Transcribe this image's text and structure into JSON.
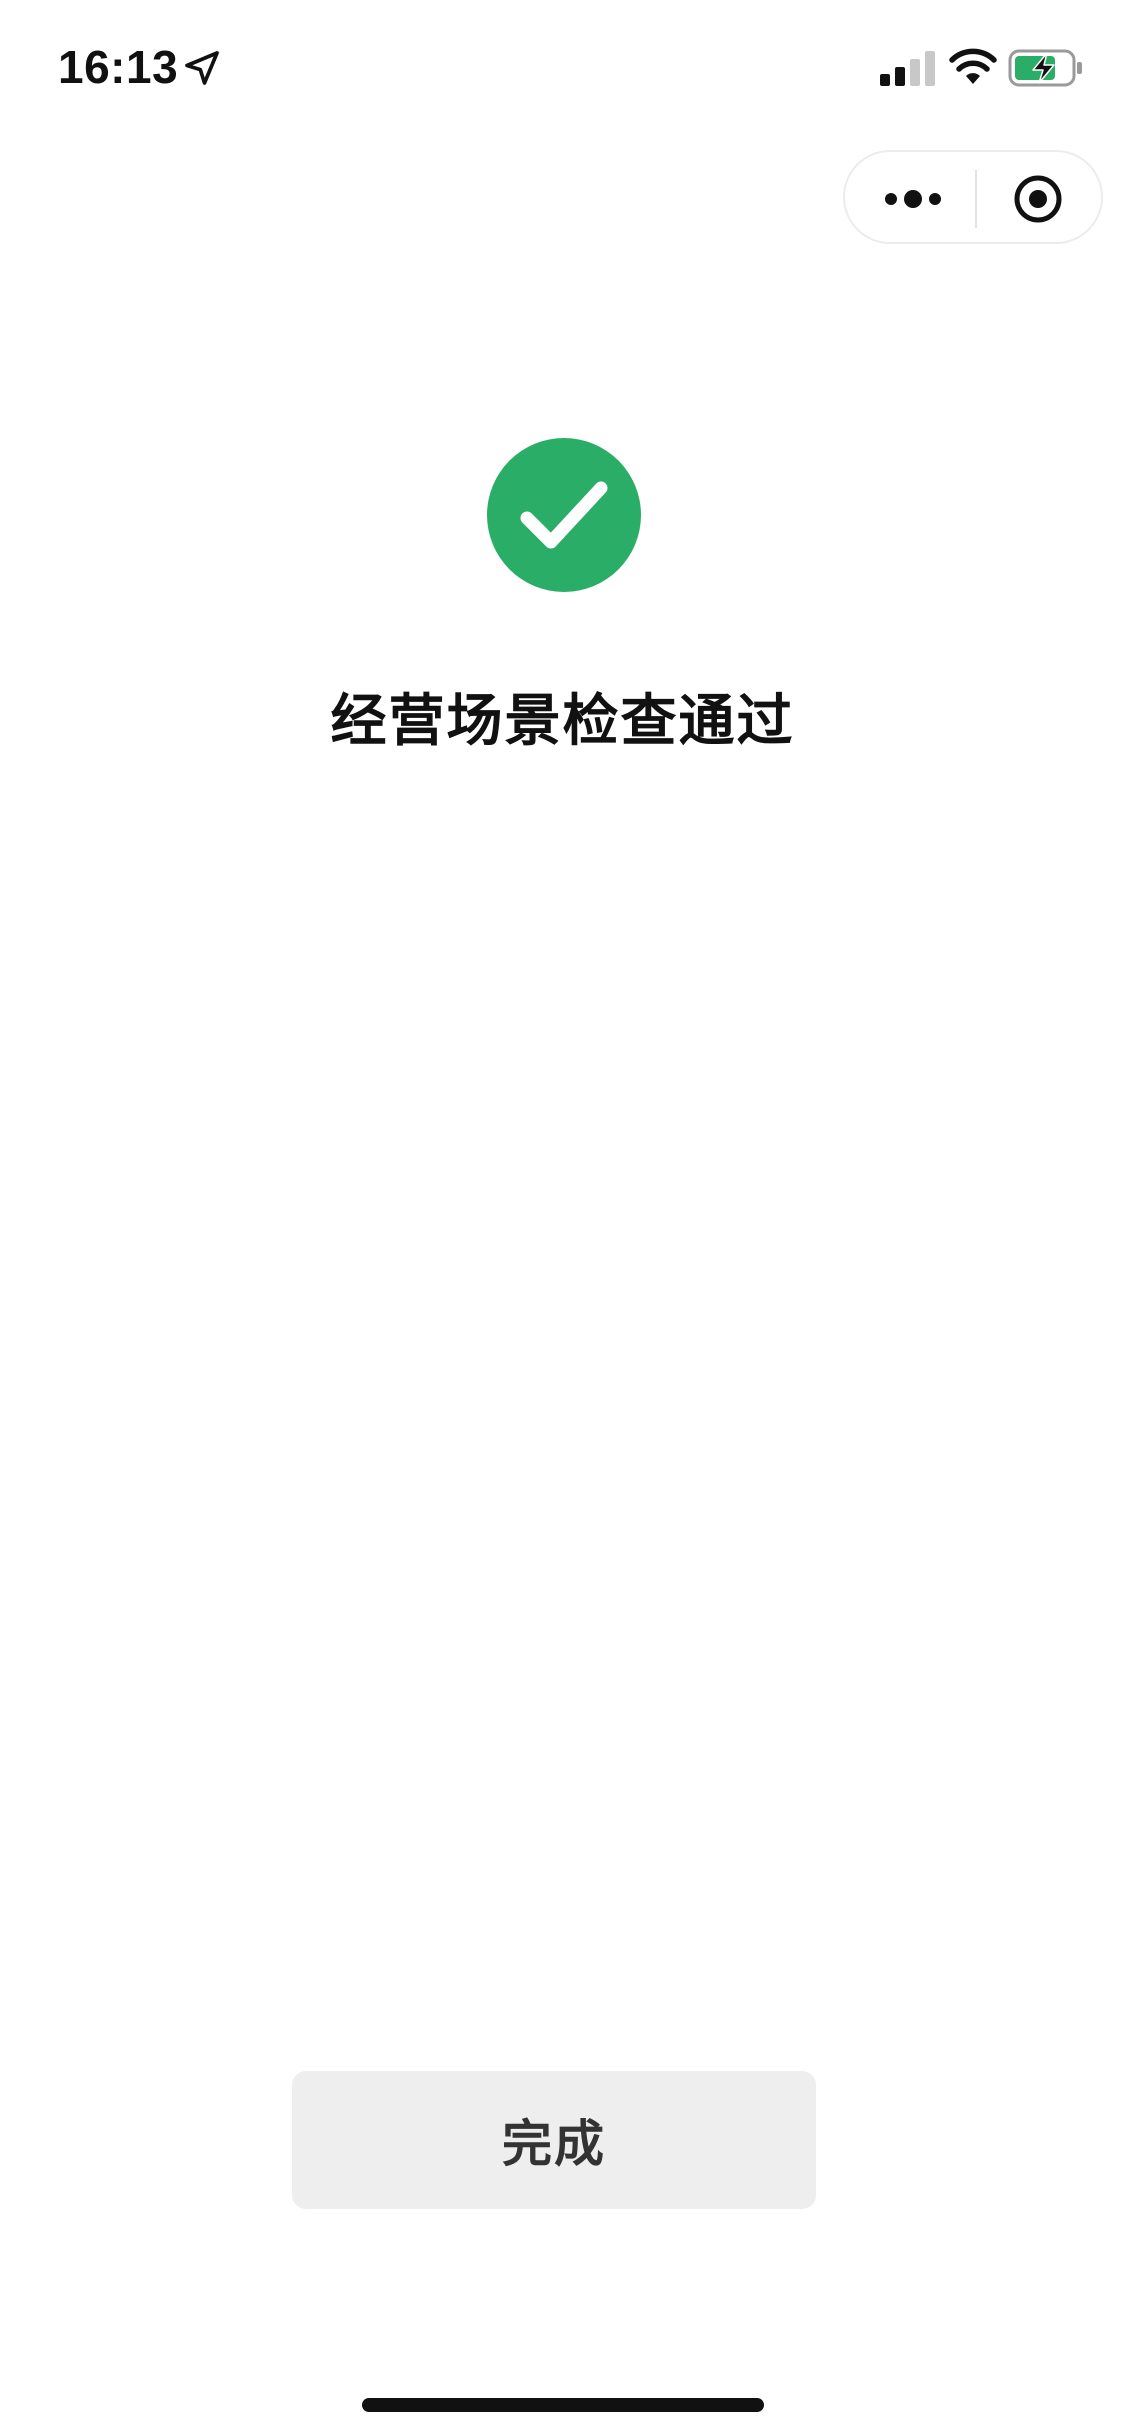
{
  "status_bar": {
    "time": "16:13",
    "icons": [
      "location-arrow-icon",
      "signal-icon",
      "wifi-icon",
      "battery-charging-icon"
    ],
    "battery_color": "#2aae67"
  },
  "capsule": {
    "icons": [
      "more-icon",
      "close-mini-program-icon"
    ]
  },
  "result": {
    "icon": "success-check-icon",
    "accent_color": "#2aae67",
    "title": "经营场景检查通过"
  },
  "actions": {
    "done_label": "完成"
  }
}
